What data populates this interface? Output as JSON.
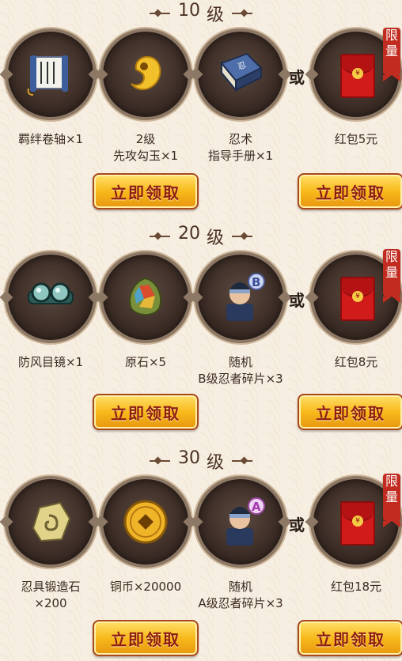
{
  "or_label": "或",
  "limited_label": "限量",
  "claim_label": "立即领取",
  "level_suffix": "级",
  "sections": [
    {
      "level": "10",
      "rewards": [
        {
          "line1": "羁绊卷轴×1",
          "line2": "",
          "icon": "scroll-icon"
        },
        {
          "line1": "2级",
          "line2": "先攻勾玉×1",
          "icon": "magatama-icon"
        },
        {
          "line1": "忍术",
          "line2": "指导手册×1",
          "icon": "ninja-manual-icon"
        }
      ],
      "alt_reward": {
        "line1": "红包5元",
        "icon": "red-envelope-icon"
      }
    },
    {
      "level": "20",
      "rewards": [
        {
          "line1": "防风目镜×1",
          "line2": "",
          "icon": "goggles-icon"
        },
        {
          "line1": "原石×5",
          "line2": "",
          "icon": "ore-stone-icon"
        },
        {
          "line1": "随机",
          "line2": "B级忍者碎片×3",
          "icon": "ninja-b-icon"
        }
      ],
      "alt_reward": {
        "line1": "红包8元",
        "icon": "red-envelope-icon"
      }
    },
    {
      "level": "30",
      "rewards": [
        {
          "line1": "忍具锻造石",
          "line2": "×200",
          "icon": "forge-stone-icon"
        },
        {
          "line1": "铜币×20000",
          "line2": "",
          "icon": "copper-coin-icon"
        },
        {
          "line1": "随机",
          "line2": "A级忍者碎片×3",
          "icon": "ninja-a-icon"
        }
      ],
      "alt_reward": {
        "line1": "红包18元",
        "icon": "red-envelope-icon"
      }
    }
  ]
}
